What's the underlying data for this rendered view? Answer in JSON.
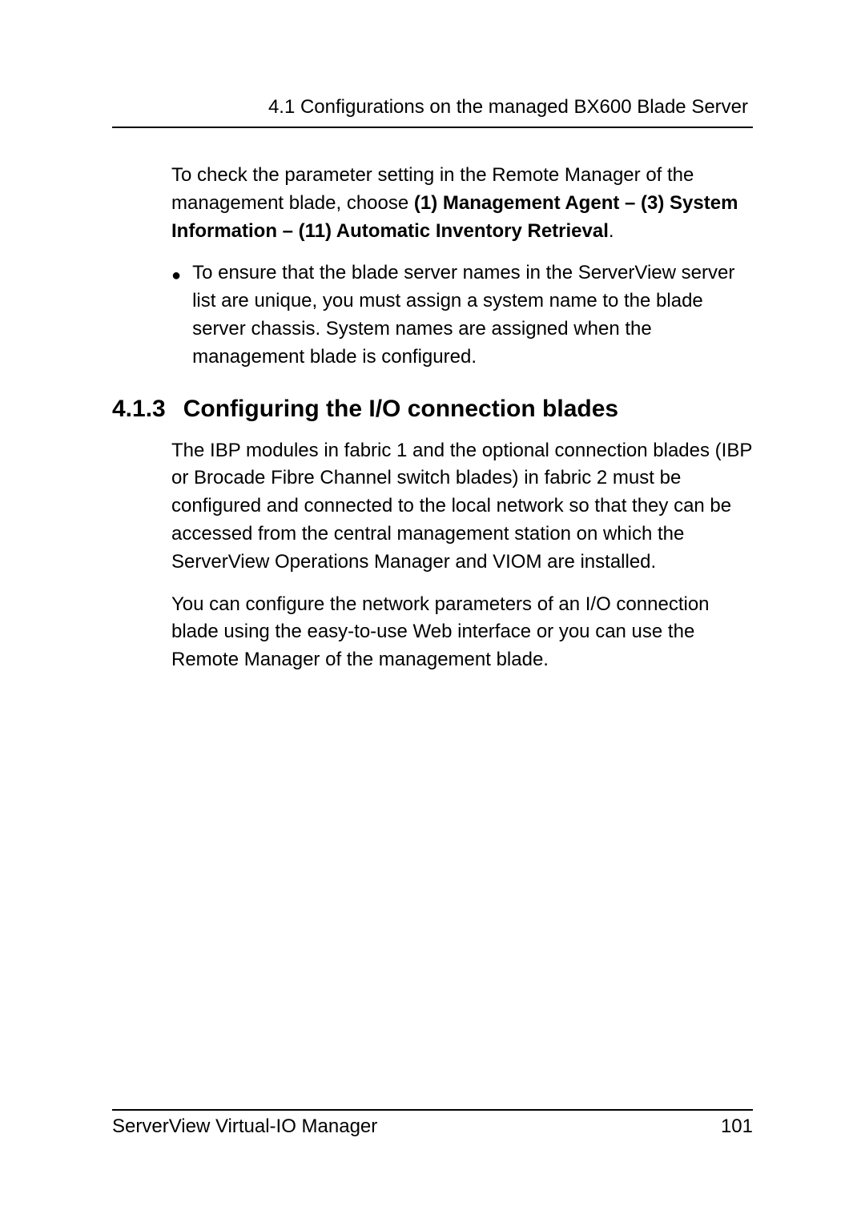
{
  "header": {
    "running_head": "4.1 Configurations on the managed BX600 Blade Server"
  },
  "body": {
    "para1_a": "To check the parameter setting in the Remote Manager of the management blade, choose ",
    "para1_bold": "(1) Management Agent – (3) System Information – (11) Automatic Inventory Retrieval",
    "para1_b": ".",
    "bullet1": "To ensure that the blade server names in the ServerView server list are unique, you must assign a system name to the blade server chassis. System names are assigned when the management blade is configured."
  },
  "section": {
    "number": "4.1.3",
    "title": "Configuring the I/O connection blades",
    "para1": "The IBP modules in fabric 1 and the optional connection blades (IBP or Brocade Fibre Channel switch blades) in fabric 2 must be configured and connected to the local network so that they can be accessed from the central management station on which the ServerView Operations Manager and VIOM are installed.",
    "para2": "You can configure the network parameters of an I/O connection blade using the easy-to-use Web interface or you can use the Remote Manager of the management blade."
  },
  "footer": {
    "left": "ServerView Virtual-IO Manager",
    "right": "101"
  }
}
